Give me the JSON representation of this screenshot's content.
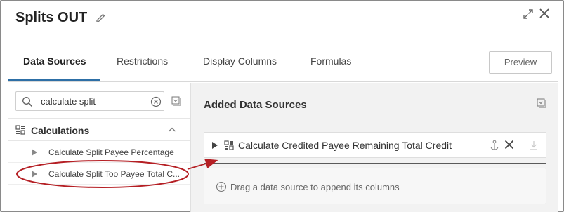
{
  "window": {
    "title": "Splits OUT",
    "edit_icon": "pencil-icon",
    "expand_icon": "expand-icon",
    "close_icon": "close-icon"
  },
  "tabs": [
    {
      "label": "Data Sources",
      "active": true
    },
    {
      "label": "Restrictions",
      "active": false
    },
    {
      "label": "Display Columns",
      "active": false
    },
    {
      "label": "Formulas",
      "active": false
    }
  ],
  "preview_button": {
    "label": "Preview"
  },
  "search": {
    "value": "calculate split",
    "icon": "search-icon",
    "clear_icon": "clear-icon"
  },
  "left_panel": {
    "collapse_icon": "collapse-all-icon",
    "group": {
      "label": "Calculations",
      "icon": "grid-icon",
      "expanded": true,
      "items": [
        {
          "label": "Calculate Split Payee Percentage"
        },
        {
          "label": "Calculate Split Too Payee Total C..."
        }
      ]
    }
  },
  "right_panel": {
    "title": "Added Data Sources",
    "collapse_icon": "collapse-all-icon",
    "data_sources": [
      {
        "label": "Calculate Credited Payee Remaining Total Credit",
        "icon": "grid-icon"
      }
    ],
    "drop_zone": {
      "label": "Drag a data source to append its columns"
    }
  },
  "colors": {
    "accent": "#2d6fa6",
    "annotation": "#b51f24",
    "panel_bg": "#f2f2f2"
  }
}
